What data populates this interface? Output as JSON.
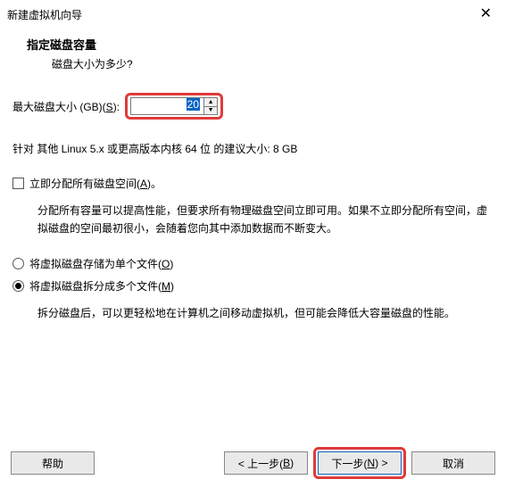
{
  "window": {
    "title": "新建虚拟机向导"
  },
  "header": {
    "title": "指定磁盘容量",
    "subtitle": "磁盘大小为多少?"
  },
  "size": {
    "label_prefix": "最大磁盘大小 (GB)(",
    "hotkey": "S",
    "label_suffix": "):",
    "value": "20"
  },
  "recommend": {
    "text": "针对 其他 Linux 5.x 或更高版本内核 64 位 的建议大小: 8 GB"
  },
  "allocate": {
    "label_prefix": "立即分配所有磁盘空间(",
    "hotkey": "A",
    "label_suffix": ")。",
    "desc": "分配所有容量可以提高性能，但要求所有物理磁盘空间立即可用。如果不立即分配所有空间，虚拟磁盘的空间最初很小，会随着您向其中添加数据而不断变大。"
  },
  "radios": {
    "single": {
      "prefix": "将虚拟磁盘存储为单个文件(",
      "hotkey": "O",
      "suffix": ")"
    },
    "split": {
      "prefix": "将虚拟磁盘拆分成多个文件(",
      "hotkey": "M",
      "suffix": ")"
    },
    "split_desc": "拆分磁盘后，可以更轻松地在计算机之间移动虚拟机，但可能会降低大容量磁盘的性能。"
  },
  "buttons": {
    "help": "帮助",
    "back_prefix": "< 上一步(",
    "back_hotkey": "B",
    "back_suffix": ")",
    "next_prefix": "下一步(",
    "next_hotkey": "N",
    "next_suffix": ") >",
    "cancel": "取消"
  }
}
